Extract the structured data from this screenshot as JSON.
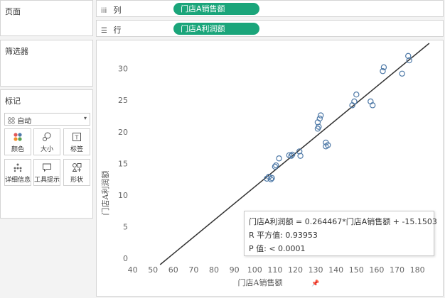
{
  "panels": {
    "pages_title": "页面",
    "filters_title": "筛选器",
    "marks_title": "标记"
  },
  "shelves": {
    "columns_label": "列",
    "columns_icon": "iii",
    "columns_pill": "门店A销售额",
    "rows_label": "行",
    "rows_icon": "☰",
    "rows_pill": "门店A利润额"
  },
  "marks": {
    "type_value": "自动",
    "buttons": [
      {
        "label": "颜色",
        "icon": "color-icon"
      },
      {
        "label": "大小",
        "icon": "size-icon"
      },
      {
        "label": "标签",
        "icon": "label-icon"
      },
      {
        "label": "详细信息",
        "icon": "detail-icon"
      },
      {
        "label": "工具提示",
        "icon": "tooltip-icon"
      },
      {
        "label": "形状",
        "icon": "shape-icon"
      }
    ]
  },
  "colors": {
    "pill": "#1aa57a",
    "point": "#4e79a7",
    "trendline": "#333333"
  },
  "chart_data": {
    "type": "scatter",
    "xlabel": "门店A销售额",
    "ylabel": "门店A利润额",
    "x_ticks": [
      40,
      50,
      60,
      70,
      80,
      90,
      100,
      110,
      120,
      130,
      140,
      150,
      160,
      170,
      180
    ],
    "y_ticks": [
      0,
      5,
      10,
      15,
      20,
      25,
      30
    ],
    "xlim": [
      37,
      188
    ],
    "ylim": [
      -1,
      34
    ],
    "grid": false,
    "points": [
      [
        106,
        12.6
      ],
      [
        107,
        12.9
      ],
      [
        108,
        12.5
      ],
      [
        108.5,
        12.7
      ],
      [
        110,
        14.5
      ],
      [
        110.5,
        14.7
      ],
      [
        112,
        15.8
      ],
      [
        117,
        16.3
      ],
      [
        118,
        16.2
      ],
      [
        118.5,
        16.4
      ],
      [
        122,
        16.9
      ],
      [
        122.5,
        16.2
      ],
      [
        131,
        20.5
      ],
      [
        131,
        21.5
      ],
      [
        131.5,
        20.8
      ],
      [
        132,
        22.1
      ],
      [
        132.5,
        22.6
      ],
      [
        135,
        17.7
      ],
      [
        135,
        18.3
      ],
      [
        136,
        17.9
      ],
      [
        148,
        24.2
      ],
      [
        149,
        24.8
      ],
      [
        150,
        25.9
      ],
      [
        157,
        24.8
      ],
      [
        158,
        24.2
      ],
      [
        163,
        29.6
      ],
      [
        163.5,
        30.2
      ],
      [
        172.5,
        29.2
      ],
      [
        175.5,
        32.0
      ],
      [
        176,
        31.3
      ]
    ],
    "trendline": {
      "slope": 0.264467,
      "intercept": -15.1503
    }
  },
  "tooltip": {
    "line1": "门店A利润额 = 0.264467*门店A销售额 + -15.1503",
    "line2": "R 平方值: 0.93953",
    "line3": "P 值: < 0.0001"
  }
}
